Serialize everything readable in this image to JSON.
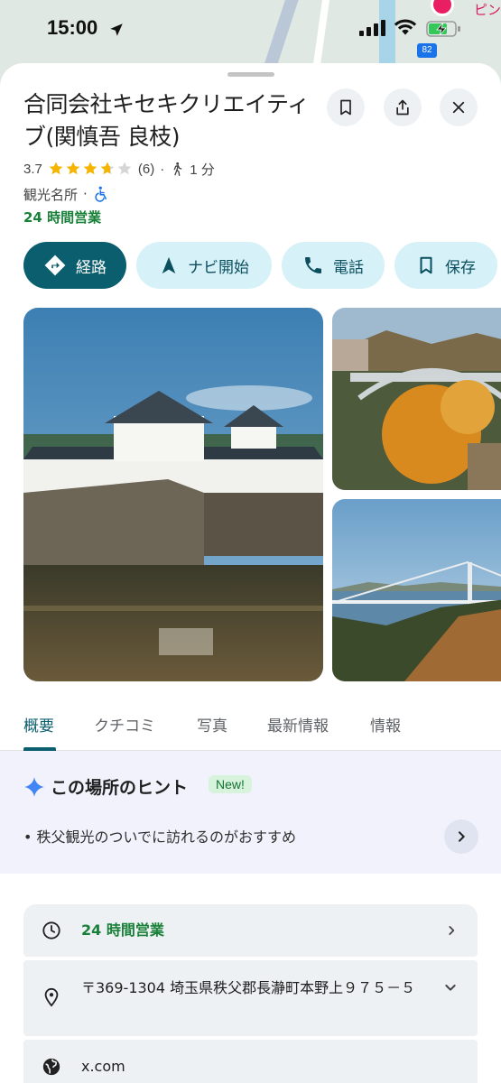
{
  "status_bar": {
    "time": "15:00"
  },
  "map": {
    "pin_label": "ピン",
    "route_badge": "82"
  },
  "place": {
    "title": "合同会社キセキクリエイティブ(関慎吾 良枝)",
    "rating": "3.7",
    "rating_value": 3.7,
    "review_count": "(6)",
    "walk_time": "1 分",
    "category": "観光名所",
    "hours_status": "24 時間営業"
  },
  "actions": [
    {
      "label": "経路",
      "icon": "directions-icon"
    },
    {
      "label": "ナビ開始",
      "icon": "navigation-icon"
    },
    {
      "label": "電話",
      "icon": "phone-icon"
    },
    {
      "label": "保存",
      "icon": "bookmark-icon"
    }
  ],
  "tabs": [
    {
      "label": "概要",
      "active": true
    },
    {
      "label": "クチコミ"
    },
    {
      "label": "写真"
    },
    {
      "label": "最新情報"
    },
    {
      "label": "情報"
    }
  ],
  "hint": {
    "title": "この場所のヒント",
    "badge": "New!",
    "text": "秩父観光のついでに訪れるのがおすすめ"
  },
  "info": {
    "hours": "24 時間営業",
    "address": "〒369-1304 埼玉県秩父郡長瀞町本野上９７５－５",
    "website": "x.com"
  },
  "colors": {
    "primary": "#0b5e6e",
    "chip": "#d6f1f8",
    "open_green": "#188038",
    "star": "#f4b400"
  }
}
